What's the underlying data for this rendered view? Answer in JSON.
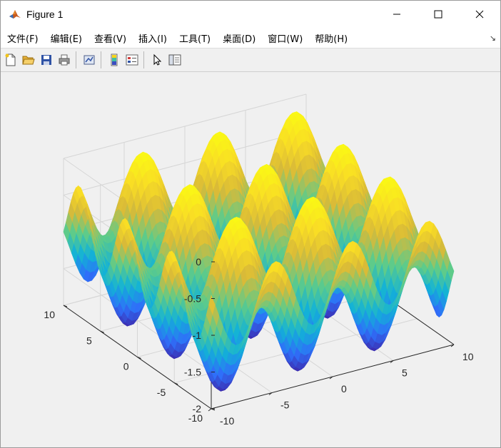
{
  "window": {
    "title": "Figure 1",
    "controls": {
      "minimize": "—",
      "maximize": "☐",
      "close": "✕"
    }
  },
  "menubar": {
    "items": [
      {
        "label": "文件(F)"
      },
      {
        "label": "编辑(E)"
      },
      {
        "label": "查看(V)"
      },
      {
        "label": "插入(I)"
      },
      {
        "label": "工具(T)"
      },
      {
        "label": "桌面(D)"
      },
      {
        "label": "窗口(W)"
      },
      {
        "label": "帮助(H)"
      }
    ],
    "dock_arrow": "↘"
  },
  "toolbar": {
    "buttons": [
      "new-figure-icon",
      "open-icon",
      "save-icon",
      "print-icon",
      "link-plot-icon",
      "colorbar-icon",
      "legend-icon",
      "pointer-icon",
      "property-inspector-icon"
    ]
  },
  "chart_data": {
    "type": "surface",
    "title": "",
    "xlabel": "",
    "ylabel": "",
    "zlabel": "",
    "xlim": [
      -10,
      10
    ],
    "ylim": [
      -10,
      10
    ],
    "zlim": [
      -2,
      0
    ],
    "xticks": [
      "-10",
      "-5",
      "0",
      "5",
      "10"
    ],
    "yticks": [
      "-10",
      "-5",
      "0",
      "5",
      "10"
    ],
    "zticks": [
      "0",
      "-0.5",
      "-1",
      "-1.5",
      "-2"
    ],
    "grid": true,
    "colormap": "parula",
    "colormap_stops": [
      "#3e26a8",
      "#2f6ff9",
      "#12b2d7",
      "#5ecb8a",
      "#d9ba38",
      "#f9dd25",
      "#fafa14"
    ],
    "surface": "z = (sin(x) + sin(y)) / 2 - 1"
  }
}
